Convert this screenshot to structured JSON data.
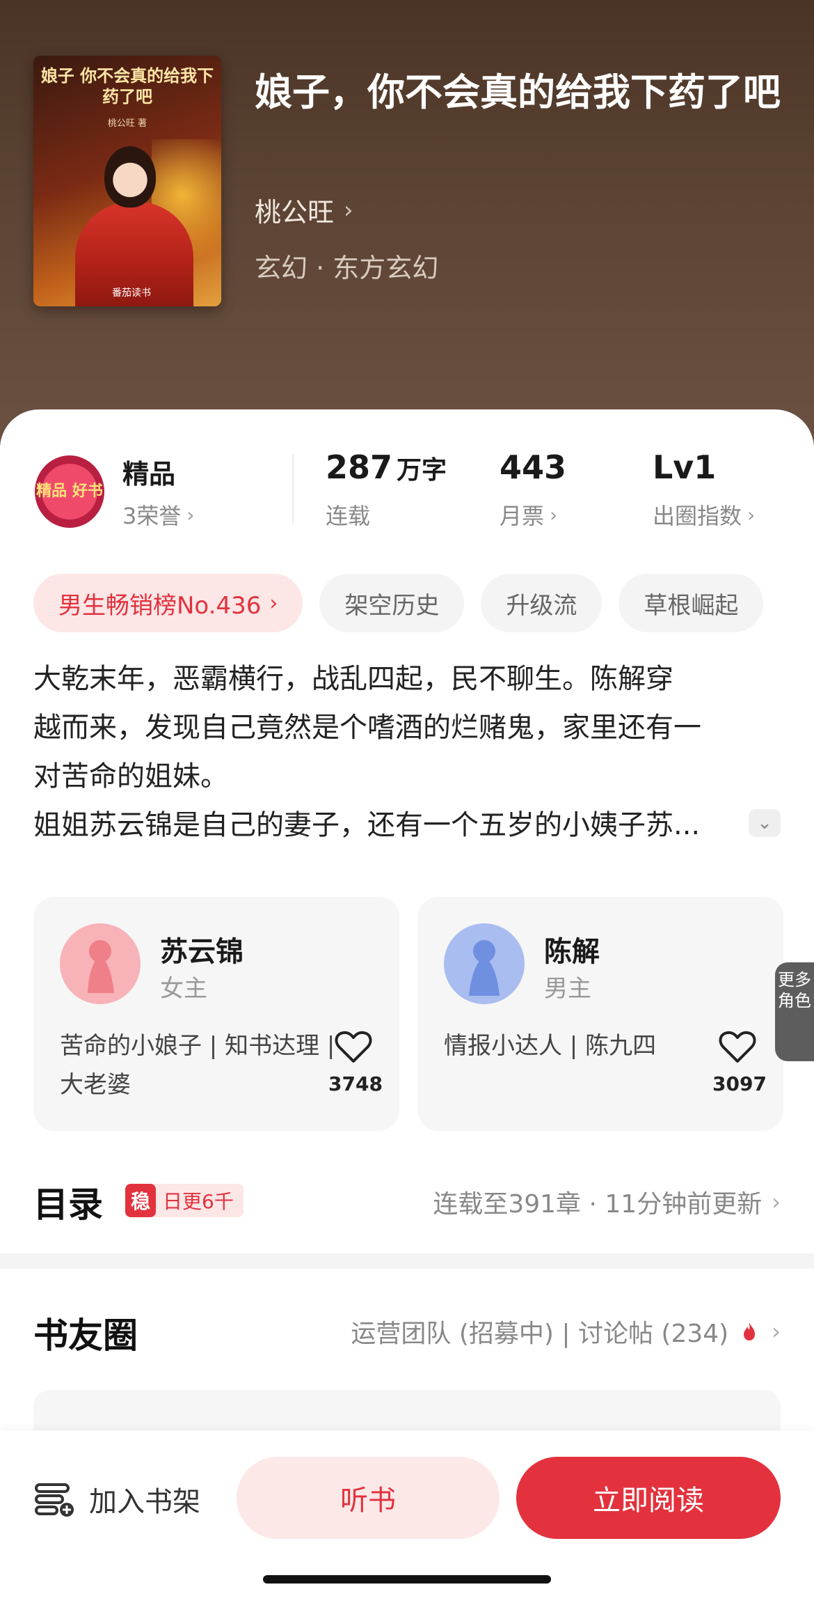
{
  "book": {
    "title": "娘子，你不会真的给我下药了吧",
    "author": "桃公旺",
    "genre": "玄幻 · 东方玄幻",
    "cover": {
      "title": "娘子 你不会真的给我下药了吧",
      "author": "桃公旺 著",
      "publisher": "番茄读书"
    }
  },
  "stats": {
    "badge_label": "精品",
    "badge_emblem": "精品 好书",
    "honor": "3荣誉",
    "words": "287",
    "words_unit": "万字",
    "words_sub": "连载",
    "tickets": "443",
    "tickets_sub": "月票",
    "level": "Lv1",
    "level_sub": "出圈指数"
  },
  "tags": [
    "男生畅销榜No.436",
    "架空历史",
    "升级流",
    "草根崛起"
  ],
  "synopsis": {
    "line1": "大乾末年，恶霸横行，战乱四起，民不聊生。陈解穿",
    "line2": "越而来，发现自己竟然是个嗜酒的烂赌鬼，家里还有一",
    "line3": "对苦命的姐妹。",
    "line4": "姐姐苏云锦是自己的妻子，还有一个五岁的小姨子苏..."
  },
  "characters": [
    {
      "name": "苏云锦",
      "role": "女主",
      "desc": "苦命的小娘子 | 知书达理 | 大老婆",
      "likes": "3748",
      "avatar_color": "#f5a0a6"
    },
    {
      "name": "陈解",
      "role": "男主",
      "desc": "情报小达人 | 陈九四",
      "likes": "3097",
      "avatar_color": "#8fa8e8"
    }
  ],
  "more_roles": "更多角色",
  "toc": {
    "title": "目录",
    "badge_stamp": "稳",
    "badge_text": "日更6千",
    "info": "连载至391章 · 11分钟前更新"
  },
  "friends": {
    "title": "书友圈",
    "info": "运营团队 (招募中) | 讨论帖 (234)"
  },
  "bottom": {
    "shelf": "加入书架",
    "listen": "听书",
    "read": "立即阅读"
  },
  "colors": {
    "accent": "#e3323d",
    "accent_light": "#fde6e6",
    "header_bg": "#5b4232"
  }
}
